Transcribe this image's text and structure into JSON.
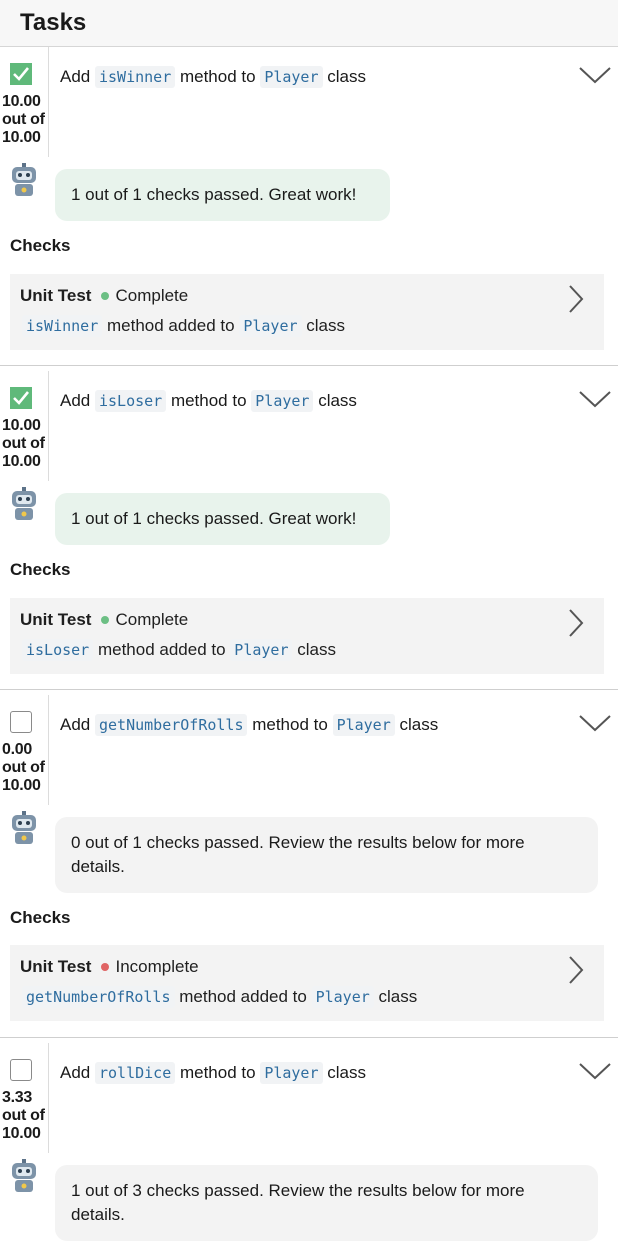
{
  "header": {
    "title": "Tasks"
  },
  "tasks": [
    {
      "checked": true,
      "title": {
        "prefix": "Add",
        "method": "isWinner",
        "middle": "method to",
        "class": "Player",
        "suffix": "class"
      },
      "score": {
        "earned": "10.00",
        "out_of": "out of",
        "total": "10.00"
      },
      "feedback": "1 out of 1 checks passed. Great work!",
      "checks_heading": "Checks",
      "check": {
        "kind": "Unit Test",
        "status": "Complete",
        "method": "isWinner",
        "middle": "method added to",
        "class": "Player",
        "suffix": "class"
      }
    },
    {
      "checked": true,
      "title": {
        "prefix": "Add",
        "method": "isLoser",
        "middle": "method to",
        "class": "Player",
        "suffix": "class"
      },
      "score": {
        "earned": "10.00",
        "out_of": "out of",
        "total": "10.00"
      },
      "feedback": "1 out of 1 checks passed. Great work!",
      "checks_heading": "Checks",
      "check": {
        "kind": "Unit Test",
        "status": "Complete",
        "method": "isLoser",
        "middle": "method added to",
        "class": "Player",
        "suffix": "class"
      }
    },
    {
      "checked": false,
      "title": {
        "prefix": "Add",
        "method": "getNumberOfRolls",
        "middle": "method to",
        "class": "Player",
        "suffix": "class"
      },
      "score": {
        "earned": "0.00",
        "out_of": "out of",
        "total": "10.00"
      },
      "feedback": "0 out of 1 checks passed. Review the results below for more details.",
      "checks_heading": "Checks",
      "check": {
        "kind": "Unit Test",
        "status": "Incomplete",
        "method": "getNumberOfRolls",
        "middle": "method added to",
        "class": "Player",
        "suffix": "class"
      }
    },
    {
      "checked": false,
      "title": {
        "prefix": "Add",
        "method": "rollDice",
        "middle": "method to",
        "class": "Player",
        "suffix": "class"
      },
      "score": {
        "earned": "3.33",
        "out_of": "out of",
        "total": "10.00"
      },
      "feedback": "1 out of 3 checks passed. Review the results below for more details."
    }
  ],
  "icons": {
    "checkbox_checked": "checkbox-checked-icon",
    "checkbox_empty": "checkbox-empty-icon",
    "expand": "chevron-down-icon",
    "open_check": "chevron-right-icon",
    "assistant": "robot-icon"
  },
  "colors": {
    "pass_green": "#5fb97a",
    "fail_red": "#e06464",
    "code_blue": "#2f6d9f",
    "pass_bubble": "#e8f3ec"
  }
}
